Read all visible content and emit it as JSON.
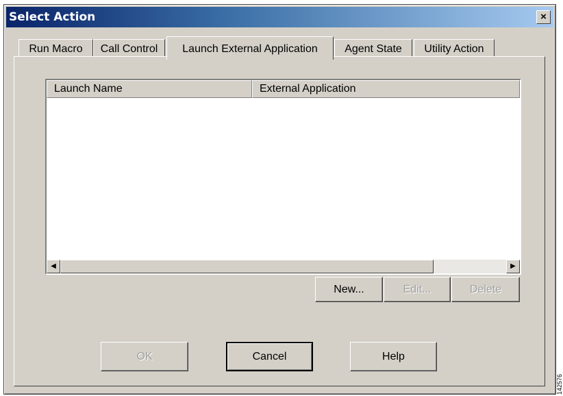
{
  "window": {
    "title": "Select Action",
    "close_symbol": "×"
  },
  "tabs": [
    {
      "label": "Run Macro",
      "active": false
    },
    {
      "label": "Call Control",
      "active": false
    },
    {
      "label": "Launch External Application",
      "active": true
    },
    {
      "label": "Agent State",
      "active": false
    },
    {
      "label": "Utility Action",
      "active": false
    }
  ],
  "list": {
    "columns": [
      "Launch Name",
      "External Application"
    ],
    "rows": []
  },
  "scrollbar": {
    "left_arrow": "◀",
    "right_arrow": "▶"
  },
  "list_buttons": {
    "new": "New...",
    "edit": "Edit...",
    "delete": "Delete"
  },
  "dialog_buttons": {
    "ok": "OK",
    "cancel": "Cancel",
    "help": "Help"
  },
  "figure_id": "142576"
}
